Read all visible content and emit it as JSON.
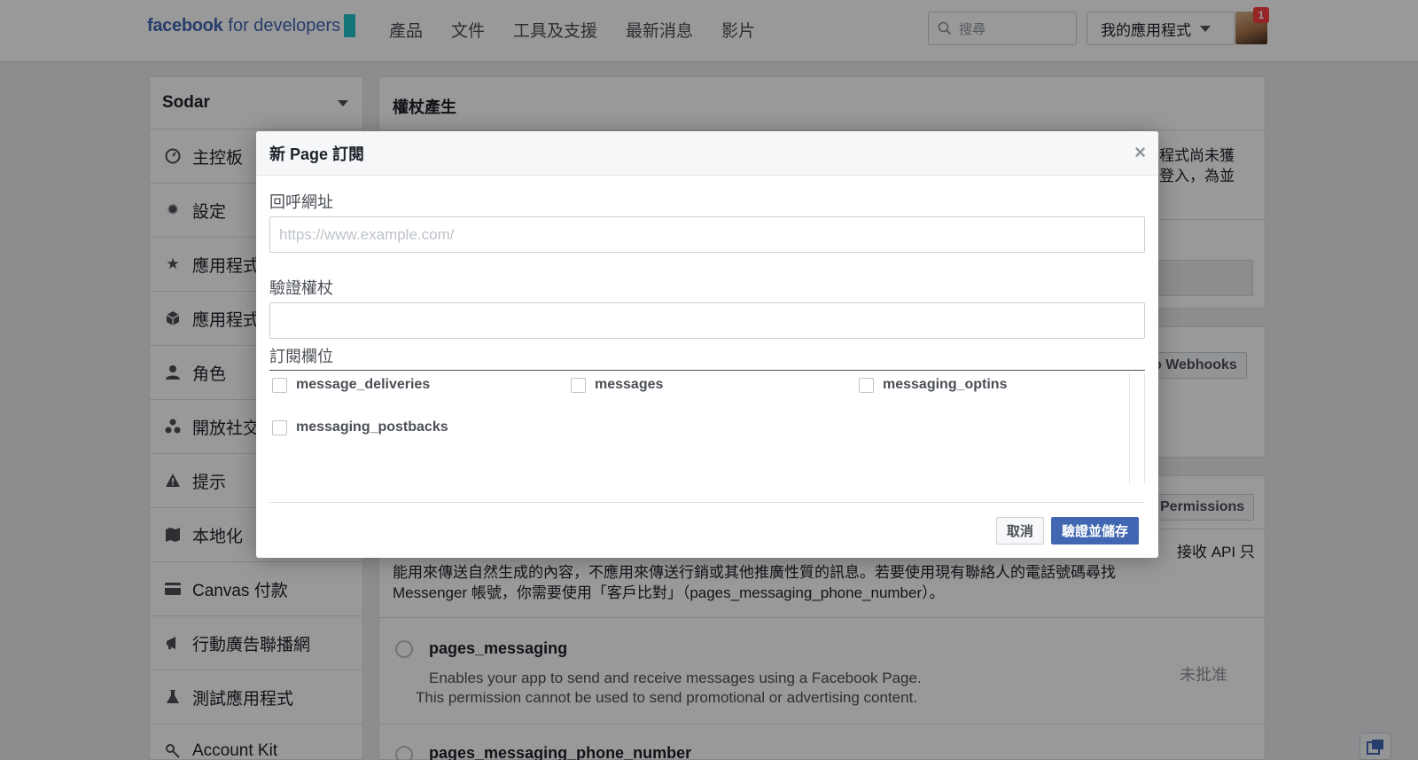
{
  "topbar": {
    "logo_bold": "facebook",
    "logo_rest": "for developers",
    "nav": [
      "產品",
      "文件",
      "工具及支援",
      "最新消息",
      "影片"
    ],
    "search_placeholder": "搜尋",
    "my_apps": "我的應用程式",
    "notification_count": "1"
  },
  "sidebar": {
    "app_name": "Sodar",
    "items": [
      {
        "label": "主控板",
        "icon": "dashboard-icon"
      },
      {
        "label": "設定",
        "icon": "gear-icon"
      },
      {
        "label": "應用程式",
        "icon": "star-icon"
      },
      {
        "label": "應用程式",
        "icon": "cube-icon"
      },
      {
        "label": "角色",
        "icon": "person-icon"
      },
      {
        "label": "開放社交",
        "icon": "graph-icon"
      },
      {
        "label": "提示",
        "icon": "warning-icon"
      },
      {
        "label": "本地化",
        "icon": "flag-icon"
      },
      {
        "label": "Canvas 付款",
        "icon": "card-icon"
      },
      {
        "label": "行動廣告聯播網",
        "icon": "megaphone-icon"
      },
      {
        "label": "測試應用程式",
        "icon": "flask-icon"
      },
      {
        "label": "Account Kit",
        "icon": "key-icon"
      }
    ]
  },
  "main": {
    "token_card_title": "權杖產生",
    "token_text_line1": "程式尚未獲",
    "token_text_line2": "登入，為並",
    "webhooks_button": "o Webhooks",
    "permissions_button": "Permissions",
    "perm_text_line0": "接收 API 只",
    "perm_text_line1": "能用來傳送自然生成的內容，不應用來傳送行銷或其他推廣性質的訊息。若要使用現有聯絡人的電話號碼尋找",
    "perm_text_line2": "Messenger 帳號，你需要使用「客戶比對」（pages_messaging_phone_number）。",
    "permissions": [
      {
        "name": "pages_messaging",
        "desc_line1": "Enables your app to send and receive messages using a Facebook Page.",
        "desc_line2": "This permission cannot be used to send promotional or advertising content.",
        "status": "未批准"
      },
      {
        "name": "pages_messaging_phone_number"
      }
    ]
  },
  "modal": {
    "title": "新 Page 訂閱",
    "close_symbol": "×",
    "callback_label": "回呼網址",
    "callback_placeholder": "https://www.example.com/",
    "callback_value": "",
    "verify_label": "驗證權杖",
    "verify_value": "",
    "fields_label": "訂閱欄位",
    "fields": [
      {
        "name": "message_deliveries",
        "checked": false
      },
      {
        "name": "messages",
        "checked": false
      },
      {
        "name": "messaging_optins",
        "checked": false
      },
      {
        "name": "messaging_postbacks",
        "checked": false
      }
    ],
    "cancel_label": "取消",
    "save_label": "驗證並儲存"
  },
  "colors": {
    "brand_blue": "#4267b2",
    "logo_accent": "#1fc1c9",
    "badge_red": "#fa3e3e"
  }
}
